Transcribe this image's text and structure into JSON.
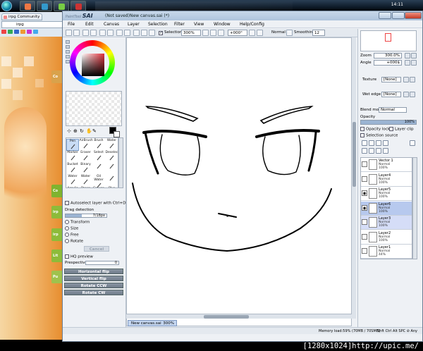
{
  "taskbar": {
    "clock": "14:11"
  },
  "browser": {
    "tab_label": "irpg Community",
    "address": "irpg",
    "side_labels": [
      "Co",
      "irp",
      "irp",
      "Lit",
      "Pu"
    ]
  },
  "sai": {
    "logo_small": "PaintTool",
    "logo_big": "SAI",
    "title": "(Not saved)New canvas.sai (*)",
    "menu": [
      "File",
      "Edit",
      "Canvas",
      "Layer",
      "Selection",
      "Filter",
      "View",
      "Window",
      "Help/Config"
    ],
    "toolbar": {
      "selection_label": "Selection",
      "zoom": "300%",
      "rotation": "+000°",
      "blend": "Normal",
      "smoothing_label": "Smoothing",
      "smoothing_value": "12"
    },
    "left": {
      "brushes": [
        "Pen",
        "AirBrush",
        "Brush",
        "Water",
        "Marker",
        "Eraser",
        "Select",
        "Deselect",
        "Bucket",
        "Binary",
        "",
        "",
        "Water",
        "Water",
        "Oil Water",
        "",
        "Acrylic",
        "Paper",
        "Crayon",
        "Blur"
      ],
      "autoselect": "Autoselect layer with Ctrl+Drag",
      "drag_detection_label": "Drag detection",
      "drag_detection_value": "7/18px",
      "drag_detection_fraction": 0.39,
      "transform_options": [
        "Transform",
        "Size",
        "Free",
        "Rotate"
      ],
      "cancel_label": "Cancel",
      "hq_preview": "HQ preview",
      "perspective_label": "Prespective",
      "perspective_value": "0",
      "buttons": [
        "Horizontal flip",
        "Vertical flip",
        "Rotate CCW",
        "Rotate CW"
      ]
    },
    "right": {
      "zoom_label": "Zoom",
      "zoom_value": "300.0%",
      "angle_label": "Angle",
      "angle_value": "+000$",
      "texture_label": "Texture",
      "texture_value": "[None]",
      "wetedge_label": "Wet edge",
      "wetedge_value": "[None]",
      "blend_label": "Blend mode",
      "blend_value": "Normal",
      "opacity_label": "Opacity",
      "opacity_value": "100%",
      "opacity_lock": "Opacity lock",
      "layer_clip": "Layer clip",
      "selection_source": "Selection source",
      "layers": [
        {
          "name": "Vector 1",
          "mode": "Normal",
          "opacity": "100%",
          "visible": false
        },
        {
          "name": "Layer4",
          "mode": "Normal",
          "opacity": "100%",
          "visible": false
        },
        {
          "name": "Layer5",
          "mode": "Normal",
          "opacity": "100%",
          "visible": true
        },
        {
          "name": "Layer6",
          "mode": "Normal",
          "opacity": "100%",
          "visible": true
        },
        {
          "name": "Layer3",
          "mode": "Normal",
          "opacity": "100%",
          "visible": false
        },
        {
          "name": "Layer2",
          "mode": "Normal",
          "opacity": "100%",
          "visible": false
        },
        {
          "name": "Layer1",
          "mode": "Normal",
          "opacity": "44%",
          "visible": false
        }
      ]
    },
    "doc_tab": {
      "name": "New canvas.sai",
      "zoom": "300%"
    },
    "status": {
      "memory": "Memory load:59% (70MB / 70SMB)",
      "indicators": "Shft Ctrl Alt SPC ⊘ Any"
    }
  },
  "watermark": "[1280x1024]http://upic.me/"
}
